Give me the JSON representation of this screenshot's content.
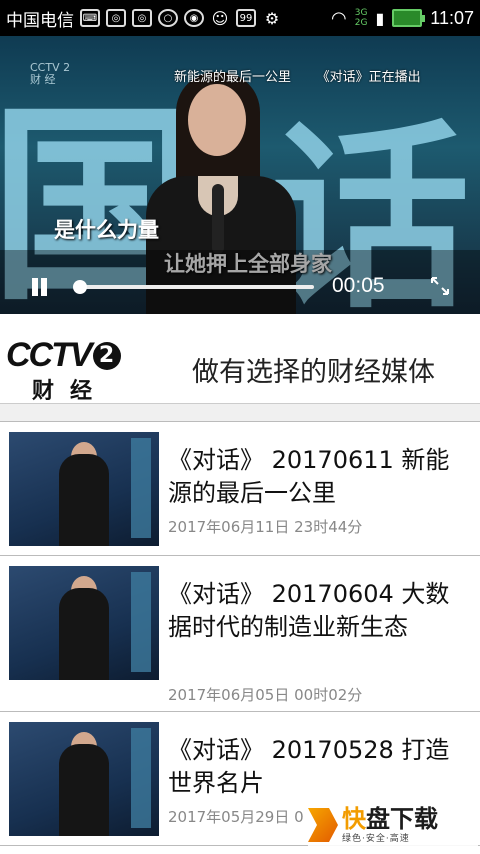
{
  "status_bar": {
    "carrier": "中国电信",
    "network": "3G 2G",
    "time": "11:07",
    "notification_icons": [
      "keyboard-icon",
      "app-icon",
      "app-icon",
      "chat-icon",
      "app-icon",
      "face-icon",
      "99-icon",
      "android-icon"
    ]
  },
  "player": {
    "top_caption_title": "新能源的最后一公里",
    "top_caption_program": "《对话》正在播出",
    "logo_line1": "CCTV 2",
    "logo_line2": "财 经",
    "subtitle_line1": "是什么力量",
    "subtitle_line2": "让她押上全部身家",
    "elapsed": "00:05",
    "progress": 0.01
  },
  "banner": {
    "logo_text": "CCTV",
    "logo_number": "2",
    "logo_sub": "财经",
    "slogan": "做有选择的财经媒体"
  },
  "episodes": [
    {
      "title": "《对话》 20170611 新能源的最后一公里",
      "date": "2017年06月11日 23时44分"
    },
    {
      "title": "《对话》 20170604 大数据时代的制造业新生态",
      "date": "2017年06月05日 00时02分"
    },
    {
      "title": "《对话》 20170528 打造世界名片",
      "date": "2017年05月29日 0"
    }
  ],
  "watermark": {
    "brand_highlight": "快",
    "brand": "盘下载",
    "tagline": "绿色·安全·高速"
  },
  "colors": {
    "accent": "#f29c00",
    "status_bar": "#000000",
    "battery": "#2a8a2a"
  }
}
